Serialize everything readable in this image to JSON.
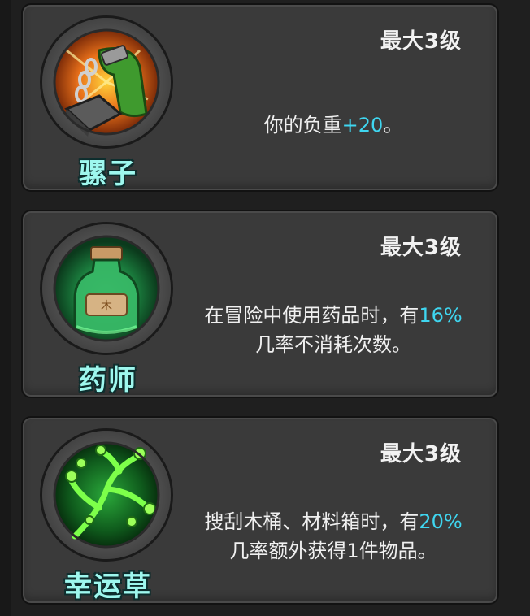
{
  "perks": [
    {
      "name": "骡子",
      "max_level": "最大3级",
      "desc_pre": "你的负重",
      "desc_value": "+20",
      "desc_post": "。",
      "desc_line2": "",
      "icon": "mule-leg-chain-icon"
    },
    {
      "name": "药师",
      "max_level": "最大3级",
      "desc_pre": "在冒险中使用药品时，有",
      "desc_value": "16%",
      "desc_post": "",
      "desc_line2": "几率不消耗次数。",
      "icon": "potion-bottle-icon"
    },
    {
      "name": "幸运草",
      "max_level": "最大3级",
      "desc_pre": "搜刮木桶、材料箱时，有",
      "desc_value": "20%",
      "desc_post": "",
      "desc_line2": "几率额外获得1件物品。",
      "icon": "clover-branch-icon"
    }
  ],
  "colors": {
    "highlight": "#3fd6f0",
    "name_text": "#9ef7ee",
    "card_bg": "#3a3a3a"
  }
}
